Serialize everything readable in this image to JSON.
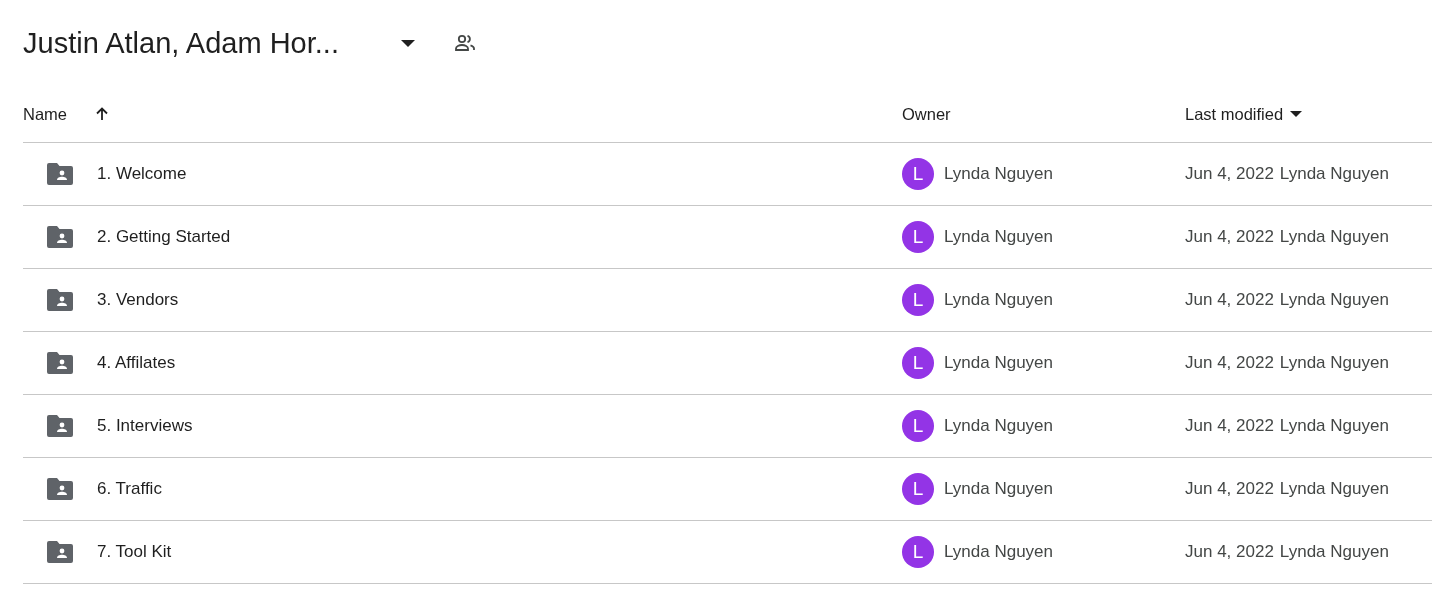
{
  "header": {
    "title": "Justin Atlan, Adam Hor..."
  },
  "table": {
    "columns": [
      {
        "label": "Name",
        "kind": "sorted"
      },
      {
        "label": "Owner",
        "kind": "plain"
      },
      {
        "label": "Last modified",
        "kind": "menu"
      }
    ],
    "rows": [
      {
        "name": "1. Welcome",
        "owner_initial": "L",
        "owner": "Lynda Nguyen",
        "modified_date": "Jun 4, 2022",
        "modified_by": "Lynda Nguyen"
      },
      {
        "name": "2. Getting Started",
        "owner_initial": "L",
        "owner": "Lynda Nguyen",
        "modified_date": "Jun 4, 2022",
        "modified_by": "Lynda Nguyen"
      },
      {
        "name": "3. Vendors",
        "owner_initial": "L",
        "owner": "Lynda Nguyen",
        "modified_date": "Jun 4, 2022",
        "modified_by": "Lynda Nguyen"
      },
      {
        "name": "4. Affilates",
        "owner_initial": "L",
        "owner": "Lynda Nguyen",
        "modified_date": "Jun 4, 2022",
        "modified_by": "Lynda Nguyen"
      },
      {
        "name": "5. Interviews",
        "owner_initial": "L",
        "owner": "Lynda Nguyen",
        "modified_date": "Jun 4, 2022",
        "modified_by": "Lynda Nguyen"
      },
      {
        "name": "6. Traffic",
        "owner_initial": "L",
        "owner": "Lynda Nguyen",
        "modified_date": "Jun 4, 2022",
        "modified_by": "Lynda Nguyen"
      },
      {
        "name": "7. Tool Kit",
        "owner_initial": "L",
        "owner": "Lynda Nguyen",
        "modified_date": "Jun 4, 2022",
        "modified_by": "Lynda Nguyen"
      }
    ]
  }
}
